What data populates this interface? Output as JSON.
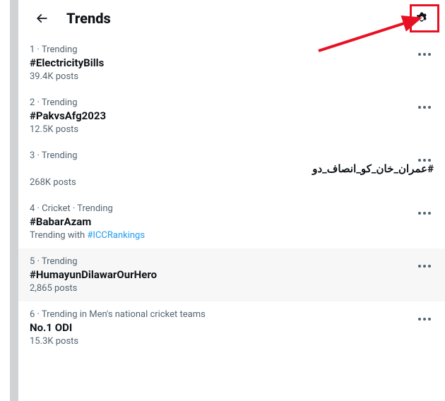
{
  "header": {
    "title": "Trends"
  },
  "trends": [
    {
      "meta": "1 · Trending",
      "topic": "#ElectricityBills",
      "posts": "39.4K posts",
      "rtl": false,
      "hovered": false
    },
    {
      "meta": "2 · Trending",
      "topic": "#PakvsAfg2023",
      "posts": "12.5K posts",
      "rtl": false,
      "hovered": false
    },
    {
      "meta": "3 · Trending",
      "topic": "#عمران_خان_کو_انصاف_دو",
      "posts": "268K posts",
      "rtl": true,
      "hovered": false
    },
    {
      "meta": "4 · Cricket · Trending",
      "topic": "#BabarAzam",
      "trending_with_prefix": "Trending with ",
      "trending_with_link": "#ICCRankings",
      "rtl": false,
      "hovered": false
    },
    {
      "meta": "5 · Trending",
      "topic": "#HumayunDilawarOurHero",
      "posts": "2,865 posts",
      "rtl": false,
      "hovered": true
    },
    {
      "meta": "6 · Trending in Men's national cricket teams",
      "topic": "No.1 ODI",
      "posts": "15.3K posts",
      "rtl": false,
      "hovered": false
    }
  ],
  "annotation": {
    "arrow_color": "#e81123",
    "highlight_color": "#e81123"
  }
}
